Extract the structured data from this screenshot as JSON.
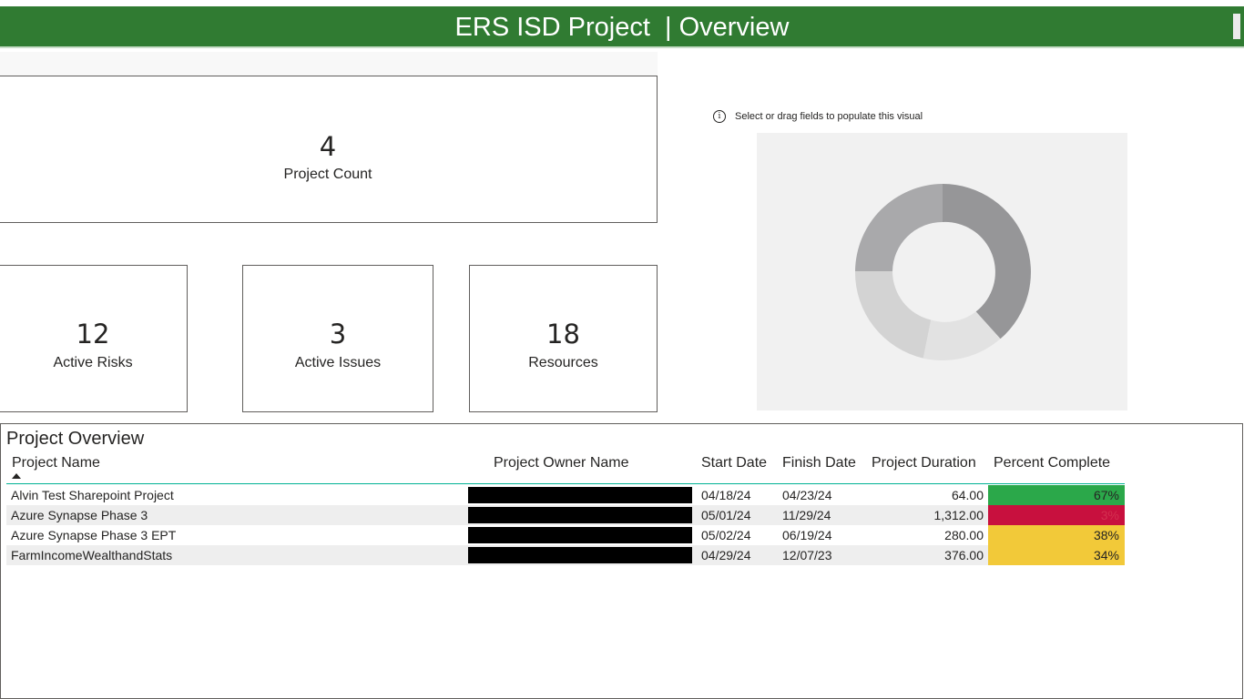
{
  "header": {
    "title": "ERS ISD Project  | Overview",
    "bg_color": "#307b32"
  },
  "cards": {
    "project_count": {
      "value": "4",
      "label": "Project Count"
    },
    "active_risks": {
      "value": "12",
      "label": "Active Risks"
    },
    "active_issues": {
      "value": "3",
      "label": "Active Issues"
    },
    "resources": {
      "value": "18",
      "label": "Resources"
    }
  },
  "empty_visual": {
    "hint": "Select or drag fields to populate this visual",
    "icon": "info-icon"
  },
  "table": {
    "title": "Project Overview",
    "columns": [
      "Project Name",
      "Project Owner Name",
      "Start Date",
      "Finish Date",
      "Project Duration",
      "Percent Complete"
    ],
    "sort_column": "Project Name",
    "rows": [
      {
        "name": "Alvin Test Sharepoint Project",
        "owner": "",
        "start": "04/18/24",
        "finish": "04/23/24",
        "duration": "64.00",
        "pct": "67%",
        "pct_color": "#2ba84a",
        "pct_text_color": "#252423"
      },
      {
        "name": "Azure Synapse Phase 3",
        "owner": "",
        "start": "05/01/24",
        "finish": "11/29/24",
        "duration": "1,312.00",
        "pct": "3%",
        "pct_color": "#c8103e",
        "pct_text_color": "#d33050"
      },
      {
        "name": "Azure Synapse Phase 3 EPT",
        "owner": "",
        "start": "05/02/24",
        "finish": "06/19/24",
        "duration": "280.00",
        "pct": "38%",
        "pct_color": "#f2c939",
        "pct_text_color": "#252423"
      },
      {
        "name": "FarmIncomeWealthandStats",
        "owner": "",
        "start": "04/29/24",
        "finish": "12/07/23",
        "duration": "376.00",
        "pct": "34%",
        "pct_color": "#f2c939",
        "pct_text_color": "#252423"
      }
    ]
  },
  "colors": {
    "table_header_line": "#00b294",
    "row_alt": "#eeeeee"
  }
}
